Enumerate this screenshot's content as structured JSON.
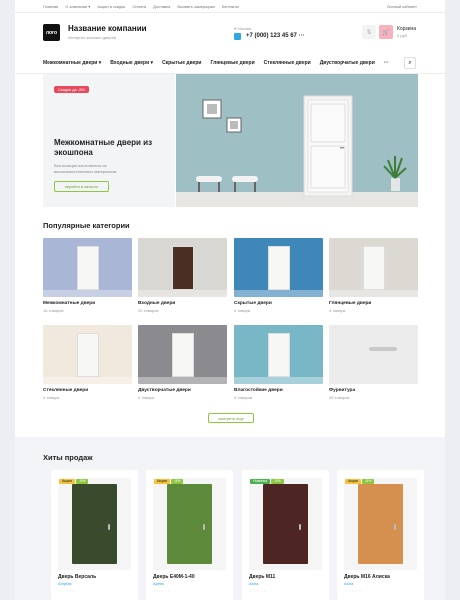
{
  "topbar": {
    "links": [
      "Главная",
      "О компании ▾",
      "Акции и скидки",
      "Оплата",
      "Доставка",
      "Вызвать замерщика",
      "Контакты"
    ],
    "cabinet": "Личный кабинет"
  },
  "header": {
    "logo": "лого",
    "company": "Название компании",
    "tagline": "Интернет-магазин дверей",
    "city": "Москва",
    "phone": "+7 (000) 123 45 67",
    "phone_more": "···",
    "cart_label": "Корзина",
    "cart_sum": "0 руб."
  },
  "nav": [
    "Межкомнатные двери ▾",
    "Входные двери ▾",
    "Скрытые двери",
    "Глянцевые двери",
    "Стеклянные двери",
    "Двустворчатые двери",
    "···"
  ],
  "hero": {
    "badge": "Скидки до -5%",
    "title": "Межкомнатные двери из экошпона",
    "desc": "Вся позиция изготовлены из высококачественных материалов",
    "button": "перейти в каталог"
  },
  "categories": {
    "title": "Популярные категории",
    "items": [
      {
        "name": "Межкомнатные двери",
        "count": "16 товаров",
        "bg": "#a9b6d6"
      },
      {
        "name": "Входные двери",
        "count": "20 товаров",
        "bg": "#d9d7d3"
      },
      {
        "name": "Скрытые двери",
        "count": "4 товара",
        "bg": "#3f87b8"
      },
      {
        "name": "Глянцевые двери",
        "count": "4 товара",
        "bg": "#dcd9d3"
      },
      {
        "name": "Стеклянные двери",
        "count": "4 товара",
        "bg": "#f1e9dd"
      },
      {
        "name": "Двустворчатые двери",
        "count": "4 товара",
        "bg": "#8a8a8f"
      },
      {
        "name": "Влагостойкие двери",
        "count": "5 товаров",
        "bg": "#78b7c6"
      },
      {
        "name": "Фурнитура",
        "count": "26 товаров",
        "bg": "#ececec"
      }
    ],
    "more": "смотреть еще"
  },
  "hits": {
    "title": "Хиты продаж",
    "products": [
      {
        "name": "Дверь Версаль",
        "brand": "Ampfas",
        "tags": [
          {
            "t": "Акция",
            "c": "y"
          },
          {
            "t": "-5%",
            "c": "g"
          }
        ],
        "door": "#3a4a2c",
        "stars": "☆☆☆☆☆"
      },
      {
        "name": "Дверь Е40М-1-40",
        "brand": "Apeks",
        "tags": [
          {
            "t": "Акция",
            "c": "y"
          },
          {
            "t": "-5%",
            "c": "g"
          }
        ],
        "door": "#5d8a3a",
        "stars": "☆☆☆☆☆"
      },
      {
        "name": "Дверь М11",
        "brand": "Astra",
        "tags": [
          {
            "t": "Новинка",
            "c": "gr"
          },
          {
            "t": "-5%",
            "c": "g"
          }
        ],
        "door": "#4d2522",
        "stars": "☆☆☆☆☆"
      },
      {
        "name": "Дверь М16 Алиска",
        "brand": "Astra",
        "tags": [
          {
            "t": "Акция",
            "c": "y"
          },
          {
            "t": "-5%",
            "c": "g"
          }
        ],
        "door": "#d59050",
        "stars": "☆☆☆☆☆"
      }
    ]
  }
}
